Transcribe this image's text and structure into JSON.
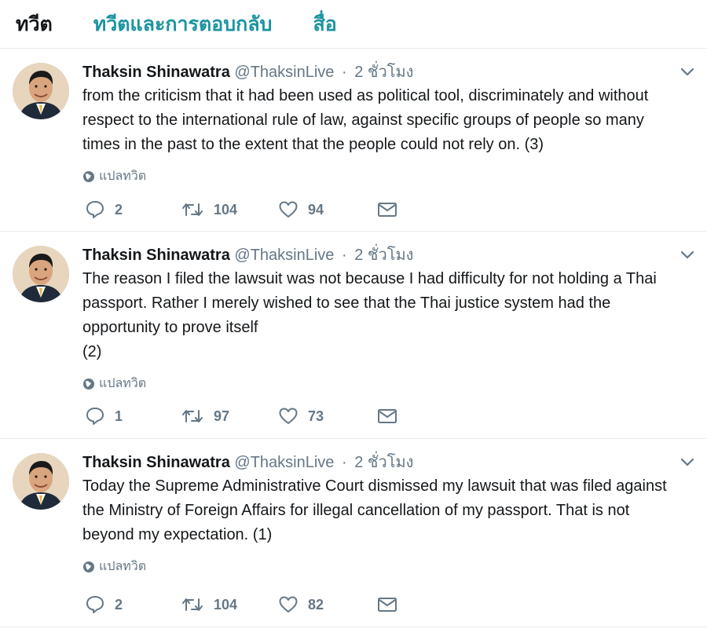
{
  "tabs": [
    {
      "label": "ทวีต",
      "active": true
    },
    {
      "label": "ทวีตและการตอบกลับ",
      "active": false
    },
    {
      "label": "สื่อ",
      "active": false
    }
  ],
  "colors": {
    "accent": "#1b95a0",
    "text": "#14171a",
    "muted": "#657786",
    "border": "#e6ecf0"
  },
  "translate_label": "แปลทวิต",
  "tweets": [
    {
      "name": "Thaksin Shinawatra",
      "handle": "@ThaksinLive",
      "time": "2 ชั่วโมง",
      "text": "from the criticism that it had been used as political tool, discriminately and without respect to the international rule of law, against specific groups of people so many times in the past to the extent that the people could not rely on. (3)",
      "replies": "2",
      "retweets": "104",
      "likes": "94"
    },
    {
      "name": "Thaksin Shinawatra",
      "handle": "@ThaksinLive",
      "time": "2 ชั่วโมง",
      "text": "The reason I filed the lawsuit was not because I had difficulty for not holding a Thai passport. Rather I merely wished to see that the Thai justice system had the opportunity to prove itself\n(2)",
      "replies": "1",
      "retweets": "97",
      "likes": "73"
    },
    {
      "name": "Thaksin Shinawatra",
      "handle": "@ThaksinLive",
      "time": "2 ชั่วโมง",
      "text": "Today the Supreme Administrative Court dismissed my lawsuit that was filed against the Ministry of Foreign Affairs for illegal cancellation of my passport. That is not beyond my expectation. (1)",
      "replies": "2",
      "retweets": "104",
      "likes": "82"
    }
  ],
  "icons": {
    "reply": "reply-icon",
    "retweet": "retweet-icon",
    "like": "heart-icon",
    "dm": "envelope-icon",
    "caret": "chevron-down-icon",
    "globe": "globe-icon"
  }
}
